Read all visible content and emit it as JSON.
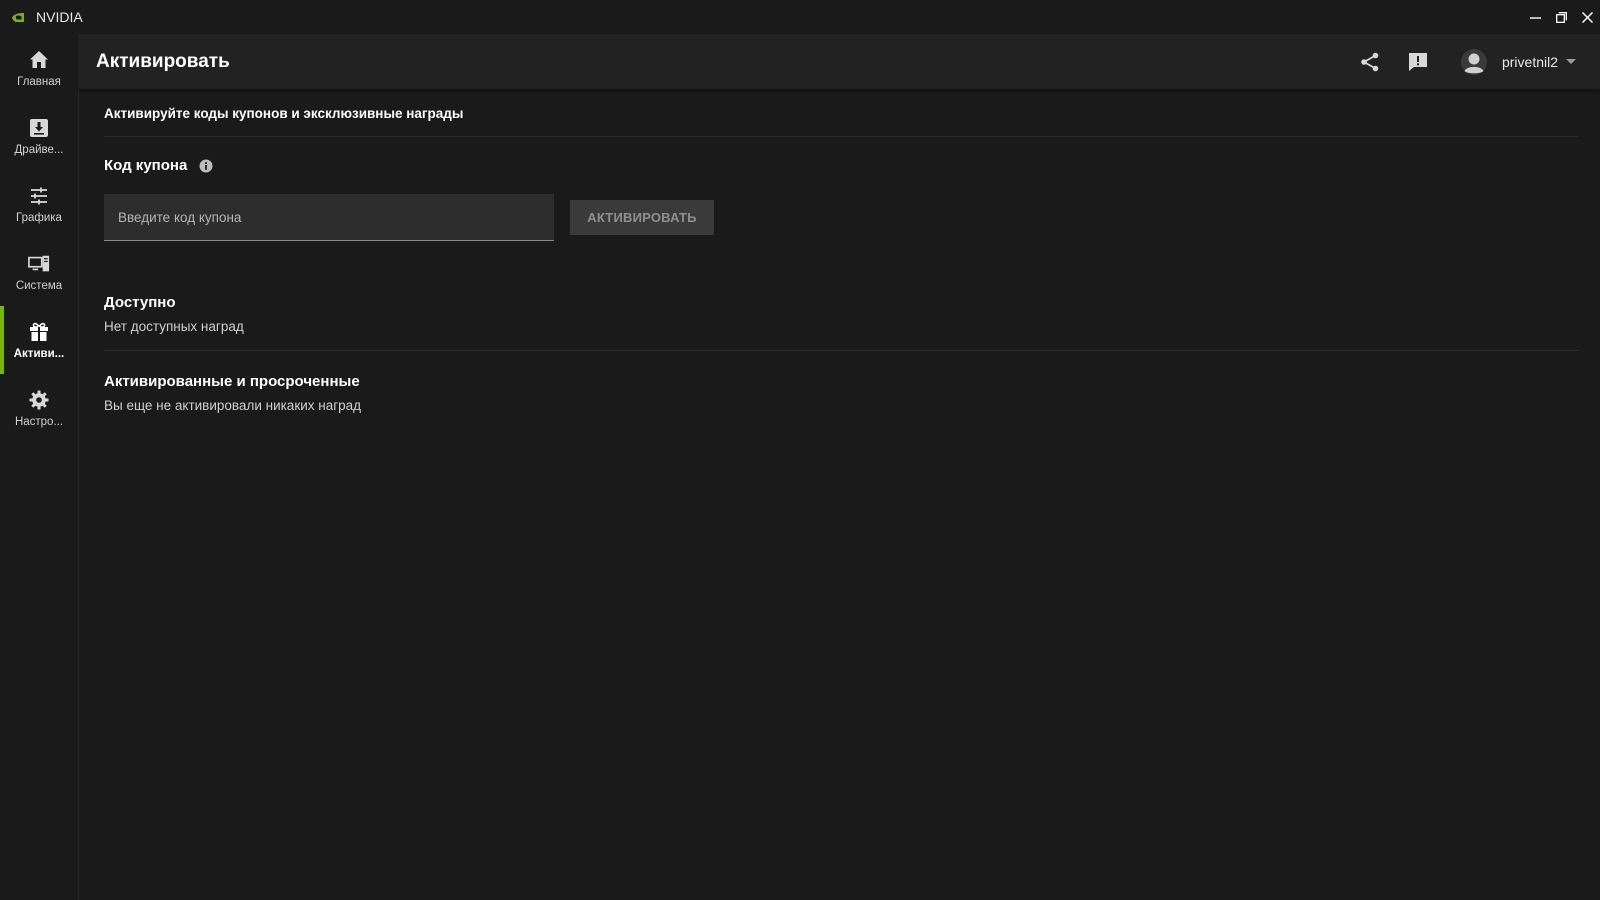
{
  "window": {
    "app_title": "NVIDIA",
    "logo_icon": "nvidia-logo-icon",
    "controls": [
      "minimize-icon",
      "restore-icon",
      "close-icon"
    ]
  },
  "colors": {
    "accent": "#76b900",
    "background": "#1a1a1a",
    "header": "#222222",
    "input": "#2d2d2d",
    "button_disabled": "#3a3a3a"
  },
  "sidebar": {
    "items": [
      {
        "label": "Главная",
        "icon": "home-icon",
        "active": false
      },
      {
        "label": "Драйве...",
        "icon": "download-icon",
        "active": false
      },
      {
        "label": "Графика",
        "icon": "sliders-icon",
        "active": false
      },
      {
        "label": "Система",
        "icon": "system-icon",
        "active": false
      },
      {
        "label": "Активи...",
        "icon": "gift-icon",
        "active": true
      },
      {
        "label": "Настро...",
        "icon": "gear-icon",
        "active": false
      }
    ]
  },
  "header": {
    "title": "Активировать",
    "share_icon": "share-icon",
    "feedback_icon": "feedback-icon",
    "username": "privetnil2",
    "avatar_icon": "avatar-icon"
  },
  "main": {
    "subtitle": "Активируйте коды купонов и эксклюзивные награды",
    "coupon_label": "Код купона",
    "coupon_placeholder": "Введите код купона",
    "coupon_value": "",
    "activate_button": "АКТИВИРОВАТЬ",
    "available_title": "Доступно",
    "available_text": "Нет доступных наград",
    "redeemed_title": "Активированные и просроченные",
    "redeemed_text": "Вы еще не активировали никаких наград"
  }
}
